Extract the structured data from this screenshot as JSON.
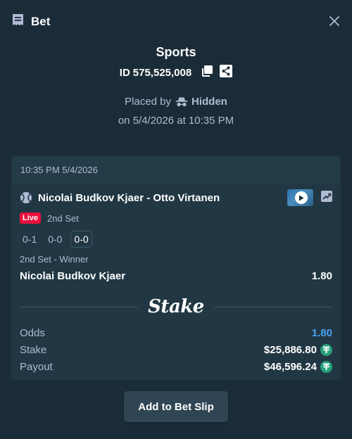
{
  "header": {
    "title": "Bet",
    "icon": "bet-slip-icon",
    "close_icon": "close-icon"
  },
  "summary": {
    "title": "Sports",
    "id_label": "ID",
    "id_value": "575,525,008",
    "placed_by_label": "Placed by",
    "placed_by_user": "Hidden",
    "date_line": "on 5/4/2026 at 10:35 PM"
  },
  "bet": {
    "timestamp": "10:35 PM 5/4/2026",
    "event": "Nicolai Budkov Kjaer - Otto Virtanen",
    "live_label": "Live",
    "period": "2nd Set",
    "scores": [
      "0-1",
      "0-0",
      "0-0"
    ],
    "market": "2nd Set - Winner",
    "selection": "Nicolai Budkov Kjaer",
    "selection_odds": "1.80",
    "brand": "Stake",
    "odds_label": "Odds",
    "odds_value": "1.80",
    "stake_label": "Stake",
    "stake_value": "$25,886.80",
    "payout_label": "Payout",
    "payout_value": "$46,596.24"
  },
  "actions": {
    "add_label": "Add to Bet Slip"
  },
  "colors": {
    "background": "#1a2c38",
    "card": "#213743",
    "accent_blue": "#4aa3f2",
    "live_red": "#e9113c",
    "tether_green": "#26a17b"
  }
}
